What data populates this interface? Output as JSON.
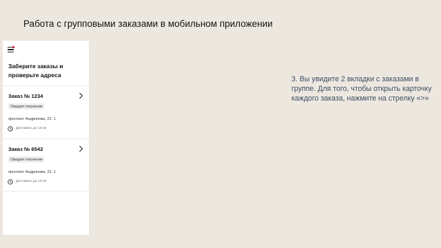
{
  "slide": {
    "title": "Работа с групповыми заказами в мобильном приложении",
    "instruction": "3. Вы увидите 2 вкладки с заказами в группе. Для того, чтобы открыть карточку каждого заказа, нажмите на стрелку «>»"
  },
  "app": {
    "heading": "Заберите заказы и проверьте адреса",
    "notification_color": "#d0021b",
    "orders": [
      {
        "title": "Заказ № 1234",
        "status": "Ожидает получения",
        "address": "проспект Андропова, 22, 1",
        "delivery": "Доставить до 13:18"
      },
      {
        "title": "Заказ № 6542",
        "status": "Ожидает получения",
        "address": "проспект Андропова, 22, 1",
        "delivery": "Доставить до 13:19"
      }
    ]
  }
}
